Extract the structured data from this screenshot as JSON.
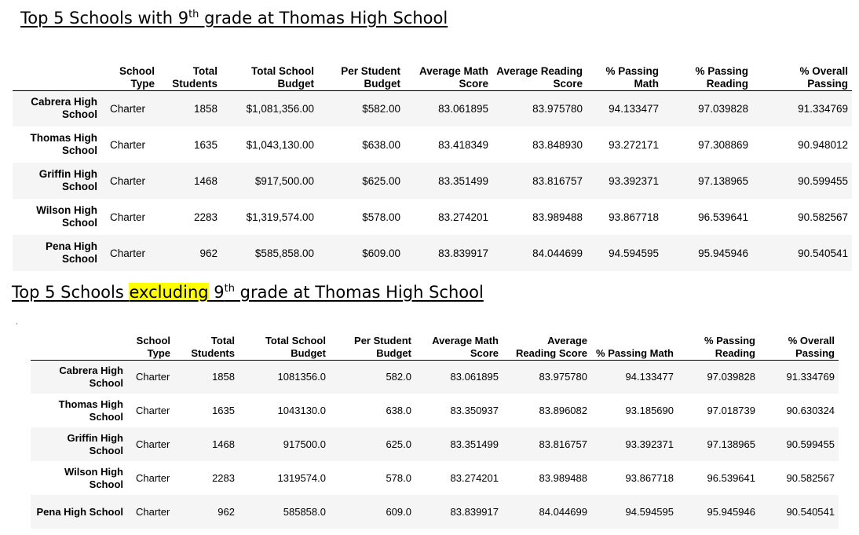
{
  "heading1": {
    "before": "Top 5 Schools with 9",
    "sup": "th",
    "after": " grade at Thomas High School"
  },
  "heading2": {
    "before": "Top 5 Schools ",
    "highlight": "excluding",
    "mid": " 9",
    "sup": "th",
    "after": " grade at Thomas High School"
  },
  "stray_mark": ",",
  "colors": {
    "highlight": "#ffff00",
    "row_stripe": "#f5f5f5"
  },
  "table1": {
    "headers": [
      "School Type",
      "Total Students",
      "Total School Budget",
      "Per Student Budget",
      "Average Math Score",
      "Average Reading Score",
      "% Passing Math",
      "% Passing Reading",
      "% Overall Passing"
    ],
    "rows": [
      {
        "name": "Cabrera High School",
        "cells": [
          "Charter",
          "1858",
          "$1,081,356.00",
          "$582.00",
          "83.061895",
          "83.975780",
          "94.133477",
          "97.039828",
          "91.334769"
        ]
      },
      {
        "name": "Thomas High School",
        "cells": [
          "Charter",
          "1635",
          "$1,043,130.00",
          "$638.00",
          "83.418349",
          "83.848930",
          "93.272171",
          "97.308869",
          "90.948012"
        ]
      },
      {
        "name": "Griffin High School",
        "cells": [
          "Charter",
          "1468",
          "$917,500.00",
          "$625.00",
          "83.351499",
          "83.816757",
          "93.392371",
          "97.138965",
          "90.599455"
        ]
      },
      {
        "name": "Wilson High School",
        "cells": [
          "Charter",
          "2283",
          "$1,319,574.00",
          "$578.00",
          "83.274201",
          "83.989488",
          "93.867718",
          "96.539641",
          "90.582567"
        ]
      },
      {
        "name": "Pena High School",
        "cells": [
          "Charter",
          "962",
          "$585,858.00",
          "$609.00",
          "83.839917",
          "84.044699",
          "94.594595",
          "95.945946",
          "90.540541"
        ]
      }
    ]
  },
  "table2": {
    "headers": [
      "School Type",
      "Total Students",
      "Total School Budget",
      "Per Student Budget",
      "Average Math Score",
      "Average Reading Score",
      "% Passing Math",
      "% Passing Reading",
      "% Overall Passing"
    ],
    "rows": [
      {
        "name": "Cabrera High School",
        "cells": [
          "Charter",
          "1858",
          "1081356.0",
          "582.0",
          "83.061895",
          "83.975780",
          "94.133477",
          "97.039828",
          "91.334769"
        ]
      },
      {
        "name": "Thomas High School",
        "cells": [
          "Charter",
          "1635",
          "1043130.0",
          "638.0",
          "83.350937",
          "83.896082",
          "93.185690",
          "97.018739",
          "90.630324"
        ]
      },
      {
        "name": "Griffin High School",
        "cells": [
          "Charter",
          "1468",
          "917500.0",
          "625.0",
          "83.351499",
          "83.816757",
          "93.392371",
          "97.138965",
          "90.599455"
        ]
      },
      {
        "name": "Wilson High School",
        "cells": [
          "Charter",
          "2283",
          "1319574.0",
          "578.0",
          "83.274201",
          "83.989488",
          "93.867718",
          "96.539641",
          "90.582567"
        ]
      },
      {
        "name": "Pena High School",
        "cells": [
          "Charter",
          "962",
          "585858.0",
          "609.0",
          "83.839917",
          "84.044699",
          "94.594595",
          "95.945946",
          "90.540541"
        ]
      }
    ]
  }
}
